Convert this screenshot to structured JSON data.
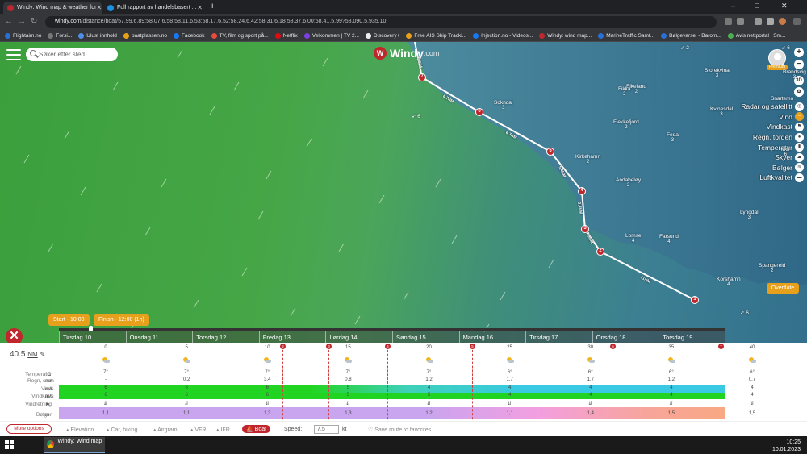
{
  "browser": {
    "tabs": [
      {
        "title": "Windy: Wind map & weather for",
        "active": true,
        "icon_color": "#c0272d"
      },
      {
        "title": "Full rapport av handelsbasert ...",
        "active": false,
        "icon_color": "#1a8fe3"
      }
    ],
    "new_tab": "+",
    "controls": {
      "minimize": "–",
      "maximize": "□",
      "close": "✕"
    },
    "url_host": "windy.com",
    "url_path": "/distance/boat/57.99,6.89;58.07,6.58;58.11,6.53;58.17,6.52;58.24,6.42;58.31,6.18;58.37,6.00;58.41,5.99?58.090,5.935,10",
    "bookmarks": [
      {
        "label": "Flightaim.no",
        "color": "#2a6fd6"
      },
      {
        "label": "Forsi...",
        "color": "#777"
      },
      {
        "label": "Ulust innhold",
        "color": "#4e8ee8"
      },
      {
        "label": "baatplassen.no",
        "color": "#e6a01c"
      },
      {
        "label": "Facebook",
        "color": "#1877f2"
      },
      {
        "label": "TV, film og sport på...",
        "color": "#e84c3d"
      },
      {
        "label": "Netflix",
        "color": "#e50914"
      },
      {
        "label": "Velkommen | TV 2...",
        "color": "#7b3fe4"
      },
      {
        "label": "Discovery+",
        "color": "#eee"
      },
      {
        "label": "Free AIS Ship Tracki...",
        "color": "#e6a01c"
      },
      {
        "label": "Injection.no - Videos...",
        "color": "#1877f2"
      },
      {
        "label": "Windy: wind map...",
        "color": "#c0272d"
      },
      {
        "label": "MarineTraffic Samt...",
        "color": "#2a6fd6"
      },
      {
        "label": "Bølgevarsel - Barom...",
        "color": "#2a6fd6"
      },
      {
        "label": "Avis nettportal | Sm...",
        "color": "#4caf50"
      }
    ]
  },
  "map": {
    "logo_main": "Windy",
    "logo_suffix": ".com",
    "logo_letter": "W",
    "search_placeholder": "Søker etter sted ...",
    "premium": "Premium",
    "overflate": "Overflate",
    "zoom_in": "+",
    "zoom_out": "−",
    "view_3d": "3D",
    "overlays": [
      {
        "label": "Radar og satellitt",
        "icon": "radar-icon",
        "glyph": "◎",
        "active": false
      },
      {
        "label": "Vind",
        "icon": "wind-icon",
        "glyph": "≈",
        "active": true
      },
      {
        "label": "Vindkast",
        "icon": "flag-icon",
        "glyph": "⚑",
        "active": false
      },
      {
        "label": "Regn, torden",
        "icon": "raindrop-icon",
        "glyph": "●",
        "active": false
      },
      {
        "label": "Temperatur",
        "icon": "thermometer-icon",
        "glyph": "▮",
        "active": false
      },
      {
        "label": "Skyer",
        "icon": "cloud-icon",
        "glyph": "☁",
        "active": false
      },
      {
        "label": "Bølger",
        "icon": "waves-icon",
        "glyph": "≋",
        "active": false
      },
      {
        "label": "Luftkvalitet",
        "icon": "car-icon",
        "glyph": "▬",
        "active": false
      }
    ],
    "cities": [
      {
        "name": "Sokndal",
        "num": "3"
      },
      {
        "name": "Flekkefjord",
        "num": "2"
      },
      {
        "name": "Eikeland",
        "num": "2"
      },
      {
        "name": "Feda",
        "num": "3"
      },
      {
        "name": "Kvinesdal",
        "num": "3"
      },
      {
        "name": "Lyngdal",
        "num": "3"
      },
      {
        "name": "Kirkehamn",
        "num": "2"
      },
      {
        "name": "Andabeløy",
        "num": "2"
      },
      {
        "name": "Lomse",
        "num": "4"
      },
      {
        "name": "Farsund",
        "num": "4"
      },
      {
        "name": "Spangereid",
        "num": "2"
      },
      {
        "name": "Korshamn",
        "num": "4"
      },
      {
        "name": "Storekvina",
        "num": "3"
      },
      {
        "name": "Fikka",
        "num": "2"
      },
      {
        "name": "Brandsvig",
        "num": "3"
      },
      {
        "name": "Snartemo",
        "num": ""
      },
      {
        "name": "Moi",
        "num": "6"
      }
    ],
    "wind_labels": [
      "6",
      "6",
      "2",
      "6"
    ],
    "route_points": [
      "1",
      "2",
      "3",
      "4",
      "5",
      "6",
      "7"
    ],
    "leg_labels": [
      "11NM",
      "2,9NM",
      "3,4NM",
      "5,4NM",
      "6,7NM",
      "6,7NM",
      "4,8NM"
    ]
  },
  "timeline": {
    "start": "Start - 10:00",
    "finish": "Finish - 12:00 (1h)",
    "close_glyph": "✕",
    "days": [
      "Tirsdag 10",
      "Onsdag 11",
      "Torsdag 12",
      "Fredag 13",
      "Lørdag 14",
      "Søndag 15",
      "Mandag 16",
      "Tirsdag 17",
      "Onsdag 18",
      "Torsdag 19"
    ]
  },
  "detail": {
    "distance_value": "40.5",
    "distance_unit": "NM",
    "rows": [
      {
        "label": "Temperatur",
        "unit": "°C"
      },
      {
        "label": "Regn, snø",
        "unit": "mm"
      },
      {
        "label": "Vind",
        "unit": "m/s"
      },
      {
        "label": "Vindkast",
        "unit": "m/s"
      },
      {
        "label": "Vindretning",
        "unit": "⚑"
      },
      {
        "label": "Bølger",
        "unit": "m"
      }
    ],
    "ticks": [
      "0",
      "5",
      "10",
      "15",
      "20",
      "25",
      "30",
      "35",
      "40"
    ],
    "markers": [
      "2",
      "3",
      "4",
      "5",
      "6",
      "7"
    ],
    "columns": [
      {
        "temp": "7°",
        "rain": "-",
        "wind": "6",
        "gust": "6",
        "dir": "⇵",
        "wave": "1,1"
      },
      {
        "temp": "7°",
        "rain": "0,2",
        "wind": "6",
        "gust": "6",
        "dir": "⇵",
        "wave": "1,1"
      },
      {
        "temp": "7°",
        "rain": "3,4",
        "wind": "6",
        "gust": "6",
        "dir": "⇵",
        "wave": "1,3"
      },
      {
        "temp": "7°",
        "rain": "0,8",
        "wind": "5",
        "gust": "5",
        "dir": "⇵",
        "wave": "1,3"
      },
      {
        "temp": "7°",
        "rain": "1,2",
        "wind": "4",
        "gust": "5",
        "dir": "⇵",
        "wave": "1,2"
      },
      {
        "temp": "6°",
        "rain": "1,7",
        "wind": "4",
        "gust": "4",
        "dir": "⇵",
        "wave": "1,1"
      },
      {
        "temp": "6°",
        "rain": "1,7",
        "wind": "4",
        "gust": "4",
        "dir": "⇵",
        "wave": "1,4"
      },
      {
        "temp": "6°",
        "rain": "1,2",
        "wind": "4",
        "gust": "4",
        "dir": "⇵",
        "wave": "1,5"
      },
      {
        "temp": "6°",
        "rain": "0,7",
        "wind": "4",
        "gust": "4",
        "dir": "⇵",
        "wave": "1,5"
      }
    ]
  },
  "bottom": {
    "more_options": "More options",
    "modes": [
      {
        "label": "Elevation",
        "icon": "mountain-icon",
        "active": false
      },
      {
        "label": "Car, hiking",
        "icon": "car-icon",
        "active": false
      },
      {
        "label": "Airgram",
        "icon": "plane-icon",
        "active": false
      },
      {
        "label": "VFR",
        "icon": "plane-icon",
        "active": false
      },
      {
        "label": "IFR",
        "icon": "plane-icon",
        "active": false
      },
      {
        "label": "Boat",
        "icon": "boat-icon",
        "active": true
      }
    ],
    "speed_label": "Speed:",
    "speed_value": "7.5",
    "speed_unit": "kt",
    "save_route": "Save route to favorites"
  },
  "taskbar": {
    "task": "Windy: Wind map ...",
    "time": "10:25",
    "date": "10.01.2023"
  },
  "colors": {
    "accent": "#c0272d",
    "orange": "#e6a01c",
    "sea_green": "#46a647",
    "land_blue": "#3c7f92"
  }
}
